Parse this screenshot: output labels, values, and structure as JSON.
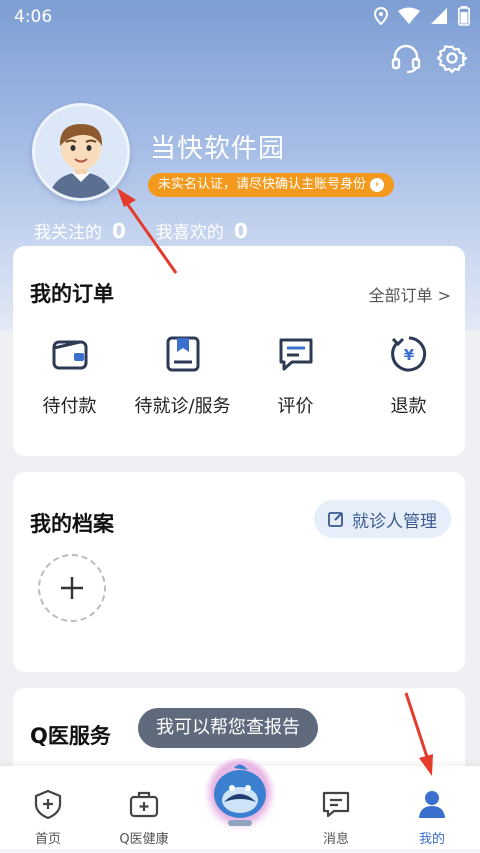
{
  "status": {
    "time": "4:06"
  },
  "profile": {
    "username": "当快软件园",
    "verify_notice": "未实名认证，请尽快确认主账号身份",
    "following_label": "我关注的",
    "following_count": "0",
    "likes_label": "我喜欢的",
    "likes_count": "0"
  },
  "orders": {
    "title": "我的订单",
    "all_link": "全部订单 >",
    "items": [
      {
        "label": "待付款",
        "icon": "wallet-icon"
      },
      {
        "label": "待就诊/服务",
        "icon": "booking-icon"
      },
      {
        "label": "评价",
        "icon": "comment-icon"
      },
      {
        "label": "退款",
        "icon": "refund-icon"
      }
    ]
  },
  "records": {
    "title": "我的档案",
    "manage_label": "就诊人管理"
  },
  "services": {
    "title": "Q医服务",
    "tooltip": "我可以帮您查报告"
  },
  "tabbar": {
    "items": [
      {
        "label": "首页"
      },
      {
        "label": "Q医健康"
      },
      {
        "label": "消息"
      },
      {
        "label": "我的"
      }
    ]
  },
  "colors": {
    "accent": "#3a6fd0",
    "badge": "#f39a1e",
    "annotation_arrow": "#e53b2c"
  }
}
